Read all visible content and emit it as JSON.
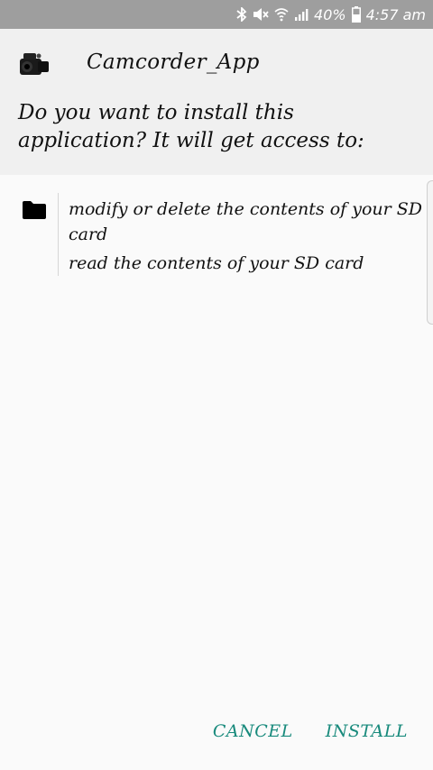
{
  "status_bar": {
    "battery_percent": "40%",
    "time": "4:57 am",
    "icons": [
      "bluetooth-icon",
      "mute-icon",
      "wifi-icon",
      "signal-icon",
      "battery-icon"
    ]
  },
  "app": {
    "name": "Camcorder_App",
    "icon": "camcorder-icon"
  },
  "dialog": {
    "question": "Do you want to install this application? It will get access to:"
  },
  "permissions": {
    "group_icon": "folder-icon",
    "items": [
      "modify or delete the contents of your SD card",
      "read the contents of your SD card"
    ]
  },
  "buttons": {
    "cancel": "CANCEL",
    "install": "INSTALL"
  },
  "colors": {
    "accent": "#188a7c",
    "status_bar": "#9e9e9e",
    "header_bg": "#f0f0f0",
    "body_bg": "#fafafa"
  }
}
